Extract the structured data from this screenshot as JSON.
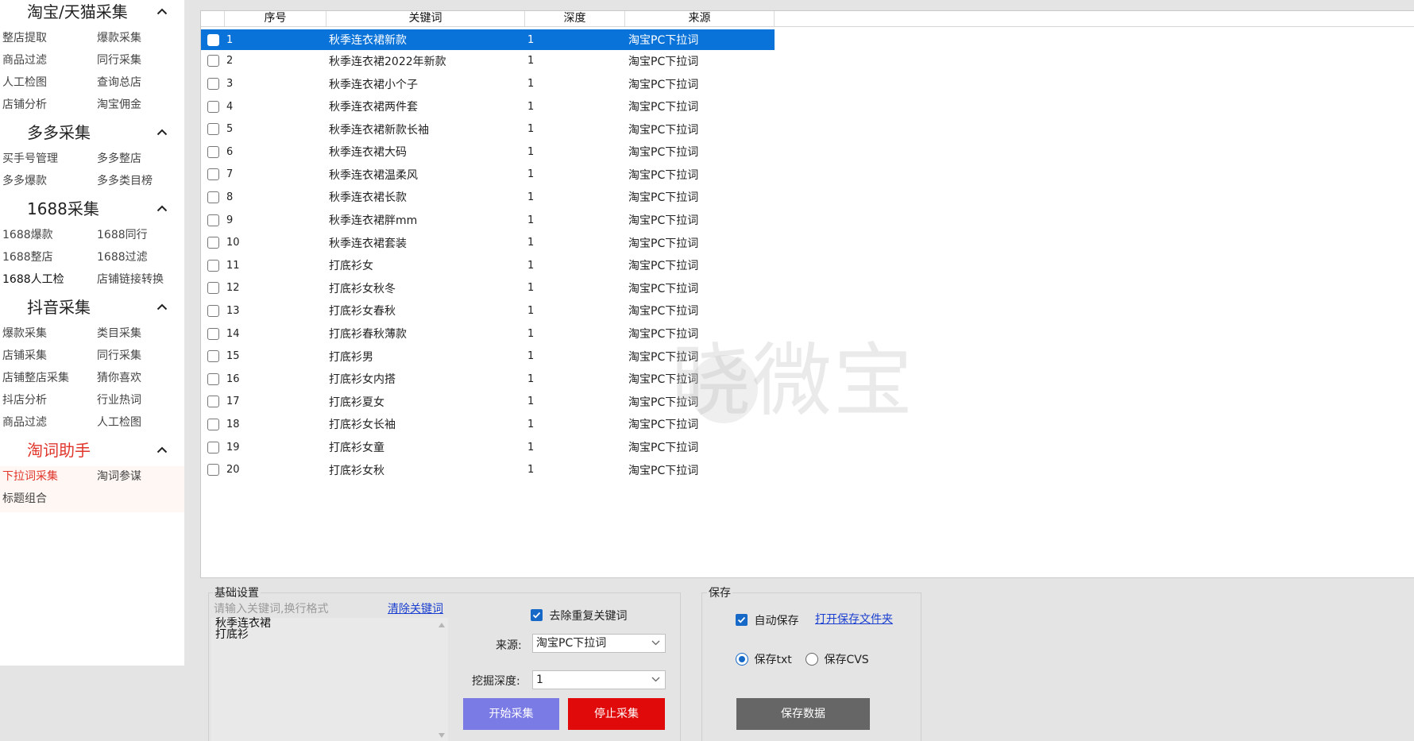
{
  "sidebar": {
    "sections": [
      {
        "title": "淘宝/天猫采集",
        "items": [
          "整店提取",
          "爆款采集",
          "商品过滤",
          "同行采集",
          "人工检图",
          "查询总店",
          "店铺分析",
          "淘宝佣金"
        ]
      },
      {
        "title": "多多采集",
        "items": [
          "买手号管理",
          "多多整店",
          "多多爆款",
          "多多类目榜"
        ]
      },
      {
        "title": "1688采集",
        "items": [
          "1688爆款",
          "1688同行",
          "1688整店",
          "1688过滤",
          "1688人工检",
          "店铺链接转换"
        ]
      },
      {
        "title": "抖音采集",
        "items": [
          "爆款采集",
          "类目采集",
          "店铺采集",
          "同行采集",
          "店铺整店采集",
          "猜你喜欢",
          "抖店分析",
          "行业热词",
          "商品过滤",
          "人工检图"
        ]
      },
      {
        "title": "淘词助手",
        "items": [
          "下拉词采集",
          "淘词参谋",
          "标题组合"
        ]
      }
    ]
  },
  "table": {
    "headers": [
      "序号",
      "关键词",
      "深度",
      "来源"
    ],
    "rows": [
      {
        "no": "1",
        "keyword": "秋季连衣裙新款",
        "depth": "1",
        "source": "淘宝PC下拉词"
      },
      {
        "no": "2",
        "keyword": "秋季连衣裙2022年新款",
        "depth": "1",
        "source": "淘宝PC下拉词"
      },
      {
        "no": "3",
        "keyword": "秋季连衣裙小个子",
        "depth": "1",
        "source": "淘宝PC下拉词"
      },
      {
        "no": "4",
        "keyword": "秋季连衣裙两件套",
        "depth": "1",
        "source": "淘宝PC下拉词"
      },
      {
        "no": "5",
        "keyword": "秋季连衣裙新款长袖",
        "depth": "1",
        "source": "淘宝PC下拉词"
      },
      {
        "no": "6",
        "keyword": "秋季连衣裙大码",
        "depth": "1",
        "source": "淘宝PC下拉词"
      },
      {
        "no": "7",
        "keyword": "秋季连衣裙温柔风",
        "depth": "1",
        "source": "淘宝PC下拉词"
      },
      {
        "no": "8",
        "keyword": "秋季连衣裙长款",
        "depth": "1",
        "source": "淘宝PC下拉词"
      },
      {
        "no": "9",
        "keyword": "秋季连衣裙胖mm",
        "depth": "1",
        "source": "淘宝PC下拉词"
      },
      {
        "no": "10",
        "keyword": "秋季连衣裙套装",
        "depth": "1",
        "source": "淘宝PC下拉词"
      },
      {
        "no": "11",
        "keyword": "打底衫女",
        "depth": "1",
        "source": "淘宝PC下拉词"
      },
      {
        "no": "12",
        "keyword": "打底衫女秋冬",
        "depth": "1",
        "source": "淘宝PC下拉词"
      },
      {
        "no": "13",
        "keyword": "打底衫女春秋",
        "depth": "1",
        "source": "淘宝PC下拉词"
      },
      {
        "no": "14",
        "keyword": "打底衫春秋薄款",
        "depth": "1",
        "source": "淘宝PC下拉词"
      },
      {
        "no": "15",
        "keyword": "打底衫男",
        "depth": "1",
        "source": "淘宝PC下拉词"
      },
      {
        "no": "16",
        "keyword": "打底衫女内搭",
        "depth": "1",
        "source": "淘宝PC下拉词"
      },
      {
        "no": "17",
        "keyword": "打底衫夏女",
        "depth": "1",
        "source": "淘宝PC下拉词"
      },
      {
        "no": "18",
        "keyword": "打底衫女长袖",
        "depth": "1",
        "source": "淘宝PC下拉词"
      },
      {
        "no": "19",
        "keyword": "打底衫女童",
        "depth": "1",
        "source": "淘宝PC下拉词"
      },
      {
        "no": "20",
        "keyword": "打底衫女秋",
        "depth": "1",
        "source": "淘宝PC下拉词"
      }
    ]
  },
  "watermark": "晓微宝",
  "basic": {
    "title": "基础设置",
    "placeholder": "请输入关键词,换行格式",
    "clear_link": "清除关键词",
    "keywords": [
      "秋季连衣裙",
      "打底衫"
    ],
    "dedupe_label": "去除重复关键词",
    "source_label": "来源:",
    "source_value": "淘宝PC下拉词",
    "depth_label": "挖掘深度:",
    "depth_value": "1",
    "start_button": "开始采集",
    "stop_button": "停止采集"
  },
  "save": {
    "title": "保存",
    "auto_save_label": "自动保存",
    "open_folder_link": "打开保存文件夹",
    "txt_label": "保存txt",
    "csv_label": "保存CVS",
    "save_button": "保存数据"
  },
  "colors": {
    "accent": "#0a73d9",
    "active_red": "#e0352b",
    "start_btn": "#7b7be6",
    "stop_btn": "#e00a0a",
    "save_btn": "#666666"
  }
}
